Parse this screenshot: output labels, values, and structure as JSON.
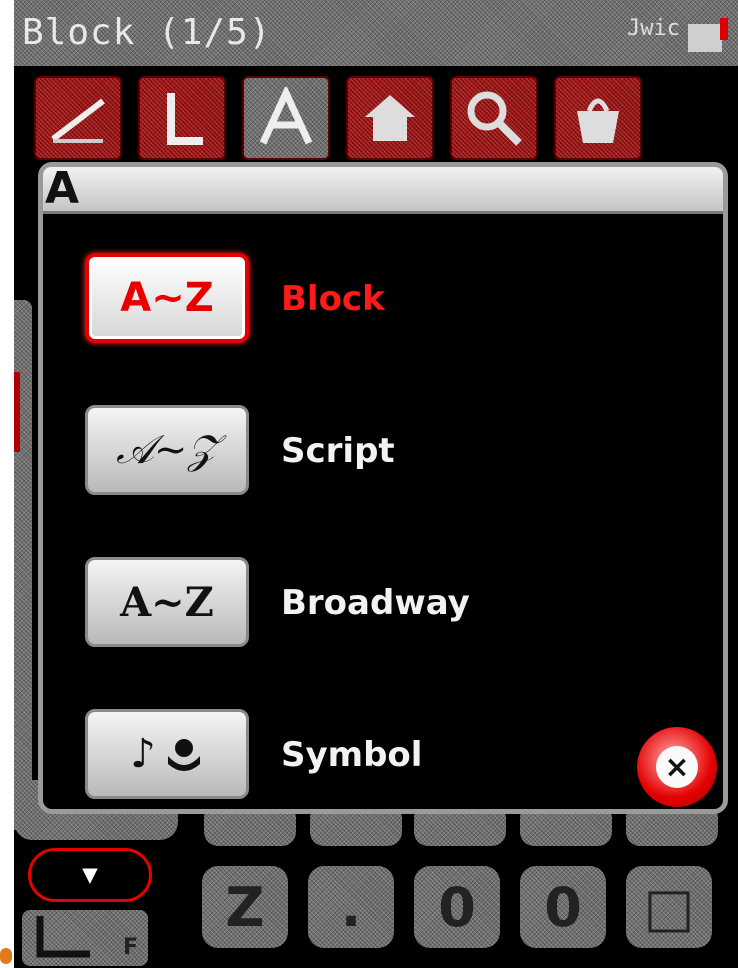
{
  "header": {
    "title": "Block (1/5)",
    "status": "Jwic"
  },
  "dialog": {
    "header_icon": "A",
    "options": [
      {
        "sample": "A~Z",
        "label": "Block",
        "selected": true
      },
      {
        "sample": "𝒜~𝒵",
        "label": "Script",
        "selected": false
      },
      {
        "sample": "A~Z",
        "label": "Broadway",
        "selected": false
      },
      {
        "sample": "♪",
        "label": "Symbol",
        "selected": false
      }
    ],
    "close_label": "×"
  },
  "bottom": {
    "keys": [
      "Z",
      ".",
      "0",
      "0",
      "□"
    ],
    "foot_label": "F"
  },
  "colors": {
    "accent": "#e60000",
    "panel": "#000000",
    "chrome": "#9a9a9a"
  }
}
